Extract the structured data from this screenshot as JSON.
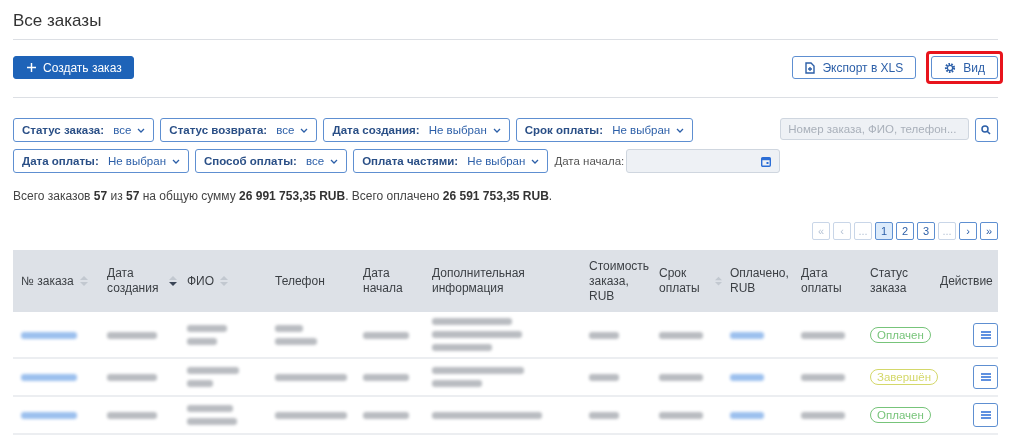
{
  "page": {
    "title": "Все заказы"
  },
  "toolbar": {
    "create_button": "Создать заказ",
    "buttons": [
      {
        "kind": "export",
        "label": "Экспорт в XLS",
        "highlighted": false
      },
      {
        "kind": "view",
        "label": "Вид",
        "highlighted": true
      }
    ]
  },
  "filters": [
    {
      "kind": "dropdown",
      "label": "Статус заказа:",
      "value": "все"
    },
    {
      "kind": "dropdown",
      "label": "Статус возврата:",
      "value": "все"
    },
    {
      "kind": "dropdown",
      "label": "Дата создания:",
      "value": "Не выбран"
    },
    {
      "kind": "dropdown",
      "label": "Срок оплаты:",
      "value": "Не выбран"
    },
    {
      "kind": "break"
    },
    {
      "kind": "dropdown",
      "label": "Дата оплаты:",
      "value": "Не выбран"
    },
    {
      "kind": "dropdown",
      "label": "Способ оплаты:",
      "value": "все"
    },
    {
      "kind": "dropdown",
      "label": "Оплата частями:",
      "value": "Не выбран"
    },
    {
      "kind": "date",
      "label": "Дата начала:"
    }
  ],
  "search": {
    "placeholder": "Номер заказа, ФИО, телефон..."
  },
  "summary": "Всего заказов **57** из **57** на общую сумму **26 991 753,35 RUB**. Всего оплачено **26 591 753,35 RUB**.",
  "pagination": [
    {
      "label": "«",
      "selected": false,
      "disabled": true
    },
    {
      "label": "‹",
      "selected": false,
      "disabled": true
    },
    {
      "label": "...",
      "selected": false,
      "disabled": true
    },
    {
      "label": "1",
      "selected": true,
      "disabled": false
    },
    {
      "label": "2",
      "selected": false,
      "disabled": false
    },
    {
      "label": "3",
      "selected": false,
      "disabled": false
    },
    {
      "label": "...",
      "selected": false,
      "disabled": true
    },
    {
      "label": "›",
      "selected": false,
      "disabled": false
    },
    {
      "label": "»",
      "selected": false,
      "disabled": false
    }
  ],
  "table": {
    "columns": [
      {
        "label": "№ заказа",
        "sortable": true,
        "sorted_desc": false
      },
      {
        "label": "Дата создания",
        "sortable": true,
        "sorted_desc": true
      },
      {
        "label": "ФИО",
        "sortable": true,
        "sorted_desc": false
      },
      {
        "label": "Телефон",
        "sortable": false
      },
      {
        "label": "Дата начала",
        "sortable": false
      },
      {
        "label": "Дополнительная информация",
        "sortable": false
      },
      {
        "label": "Стоимость заказа, RUB",
        "sortable": false
      },
      {
        "label": "Срок оплаты",
        "sortable": true,
        "sorted_desc": false
      },
      {
        "label": "Оплачено, RUB",
        "sortable": false
      },
      {
        "label": "Дата оплаты",
        "sortable": false
      },
      {
        "label": "Статус заказа",
        "sortable": false
      },
      {
        "label": "Действие",
        "sortable": false
      }
    ],
    "rows": [
      {
        "status": "Оплачен",
        "color": "#77c47a"
      },
      {
        "status": "Завершён",
        "color": "#d4d86a"
      },
      {
        "status": "Оплачен",
        "color": "#77c47a"
      }
    ]
  }
}
